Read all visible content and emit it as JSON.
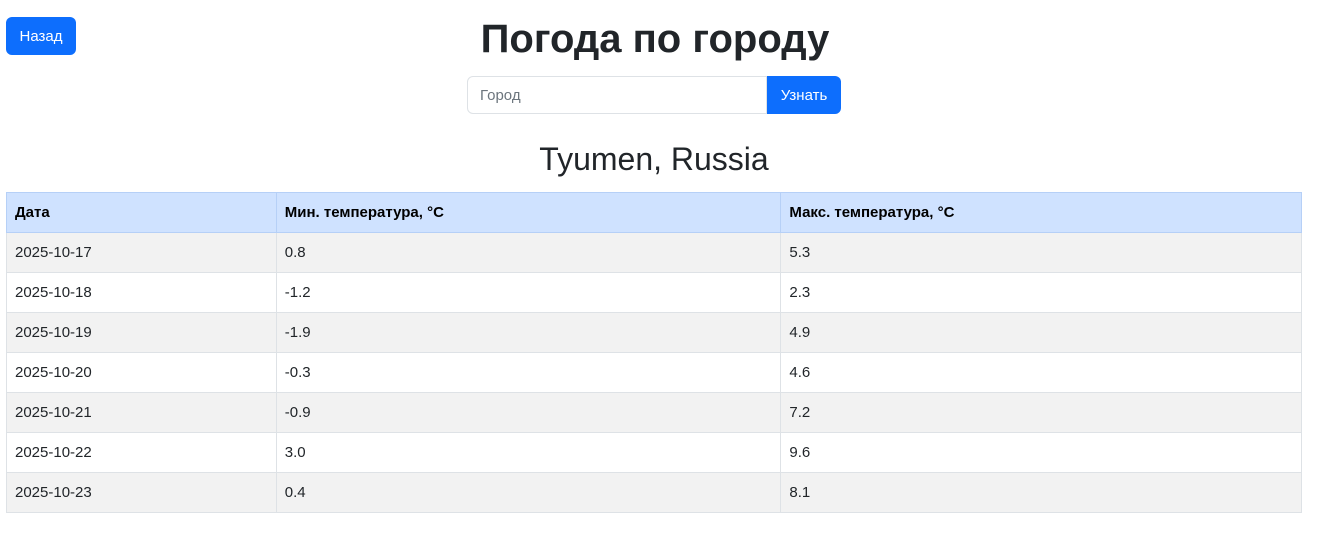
{
  "header": {
    "back_label": "Назад",
    "title": "Погода по городу"
  },
  "search": {
    "placeholder": "Город",
    "value": "",
    "submit_label": "Узнать"
  },
  "location": {
    "title": "Tyumen, Russia"
  },
  "colors": {
    "primary": "#0d6efd",
    "table_header_bg": "#cfe2ff",
    "striped_row_bg": "#f2f2f2"
  },
  "table": {
    "headers": [
      "Дата",
      "Мин. температура, °C",
      "Макс. температура, °C"
    ],
    "rows": [
      [
        "2025-10-17",
        "0.8",
        "5.3"
      ],
      [
        "2025-10-18",
        "-1.2",
        "2.3"
      ],
      [
        "2025-10-19",
        "-1.9",
        "4.9"
      ],
      [
        "2025-10-20",
        "-0.3",
        "4.6"
      ],
      [
        "2025-10-21",
        "-0.9",
        "7.2"
      ],
      [
        "2025-10-22",
        "3.0",
        "9.6"
      ],
      [
        "2025-10-23",
        "0.4",
        "8.1"
      ]
    ]
  }
}
